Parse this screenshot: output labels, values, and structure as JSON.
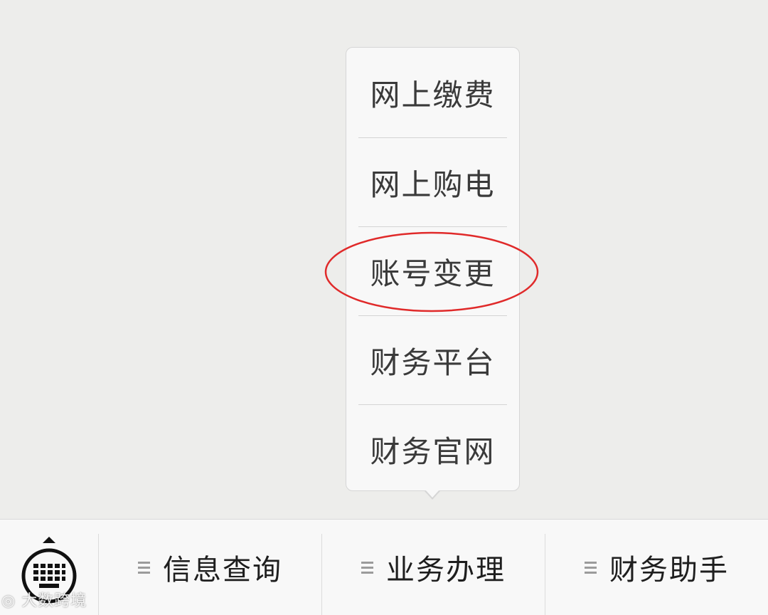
{
  "popup_menu": {
    "items": [
      {
        "label": "网上缴费"
      },
      {
        "label": "网上购电"
      },
      {
        "label": "账号变更"
      },
      {
        "label": "财务平台"
      },
      {
        "label": "财务官网"
      }
    ],
    "highlighted_item": "账号变更",
    "highlight_color": "#e02a2a"
  },
  "bottom_menu": {
    "keyboard_icon": "keyboard-icon",
    "tabs": [
      {
        "label": "信息查询",
        "icon": "menu-list-icon"
      },
      {
        "label": "业务办理",
        "icon": "menu-list-icon"
      },
      {
        "label": "财务助手",
        "icon": "menu-list-icon"
      }
    ]
  },
  "watermark": {
    "text": "大数跨境"
  },
  "colors": {
    "background": "#ededeb",
    "bar_background": "#f8f8f8",
    "text": "#1e1e1e"
  }
}
